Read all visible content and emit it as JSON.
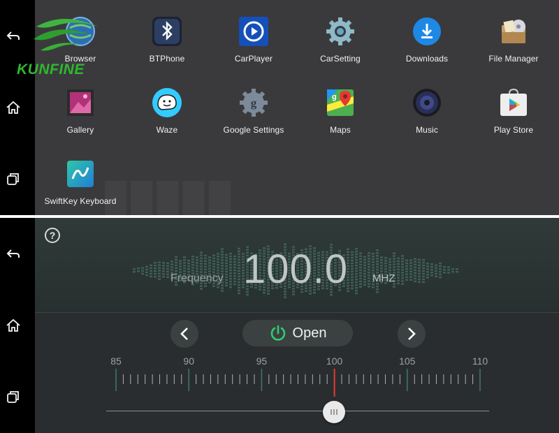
{
  "top_screen": {
    "logo_text": "KUNFINE",
    "apps": [
      {
        "label": "Browser",
        "icon": "browser-icon"
      },
      {
        "label": "BTPhone",
        "icon": "bluetooth-icon"
      },
      {
        "label": "CarPlayer",
        "icon": "car-player-icon"
      },
      {
        "label": "CarSetting",
        "icon": "gear-icon"
      },
      {
        "label": "Downloads",
        "icon": "download-icon"
      },
      {
        "label": "File Manager",
        "icon": "file-manager-icon"
      },
      {
        "label": "Gallery",
        "icon": "gallery-icon"
      },
      {
        "label": "Waze",
        "icon": "waze-icon"
      },
      {
        "label": "Google Settings",
        "icon": "google-settings-icon"
      },
      {
        "label": "Maps",
        "icon": "maps-icon"
      },
      {
        "label": "Music",
        "icon": "music-icon"
      },
      {
        "label": "Play Store",
        "icon": "play-store-icon"
      },
      {
        "label": "SwiftKey Keyboard",
        "icon": "swiftkey-icon"
      }
    ]
  },
  "nav": {
    "back_icon": "back-icon",
    "home_icon": "home-icon",
    "recents_icon": "recents-icon"
  },
  "radio": {
    "help_label": "?",
    "frequency_label": "Frequency",
    "frequency_value": "100.0",
    "unit": "MHZ",
    "open_label": "Open",
    "scale_labels": [
      "85",
      "90",
      "95",
      "100",
      "105",
      "110"
    ],
    "tuning_position_mhz": 100.0,
    "scale_min": 85,
    "scale_max": 110,
    "colors": {
      "needle": "#e53935",
      "power": "#2ecc71",
      "equalizer": "#3f5e55"
    }
  }
}
